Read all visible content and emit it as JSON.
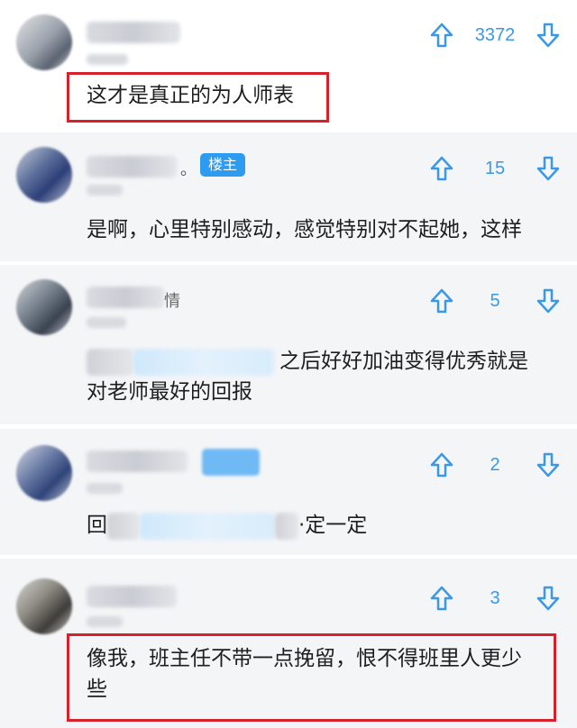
{
  "colors": {
    "accent": "#3a98e8",
    "badge": "#2d9bf0",
    "highlight": "#d8202a",
    "card_bg": "#f4f5f7"
  },
  "icons": {
    "upvote": "thumb-up-outline-arrow",
    "downvote": "thumb-down-outline-arrow"
  },
  "comments": [
    {
      "votes": "3372",
      "text": "这才是真正的为人师表"
    },
    {
      "name_suffix": "。",
      "badge": "楼主",
      "votes": "15",
      "text": "是啊，心里特别感动，感觉特别对不起她，这样"
    },
    {
      "name_suffix": "情",
      "votes": "5",
      "text_visible": "之后好好加油变得优秀就是",
      "text_line2": "对老师最好的回报"
    },
    {
      "votes": "2",
      "text_start": "回",
      "text_end": "·定一定"
    },
    {
      "votes": "3",
      "text": "像我，班主任不带一点挽留，恨不得班里人更少",
      "text_line2": "些"
    }
  ]
}
